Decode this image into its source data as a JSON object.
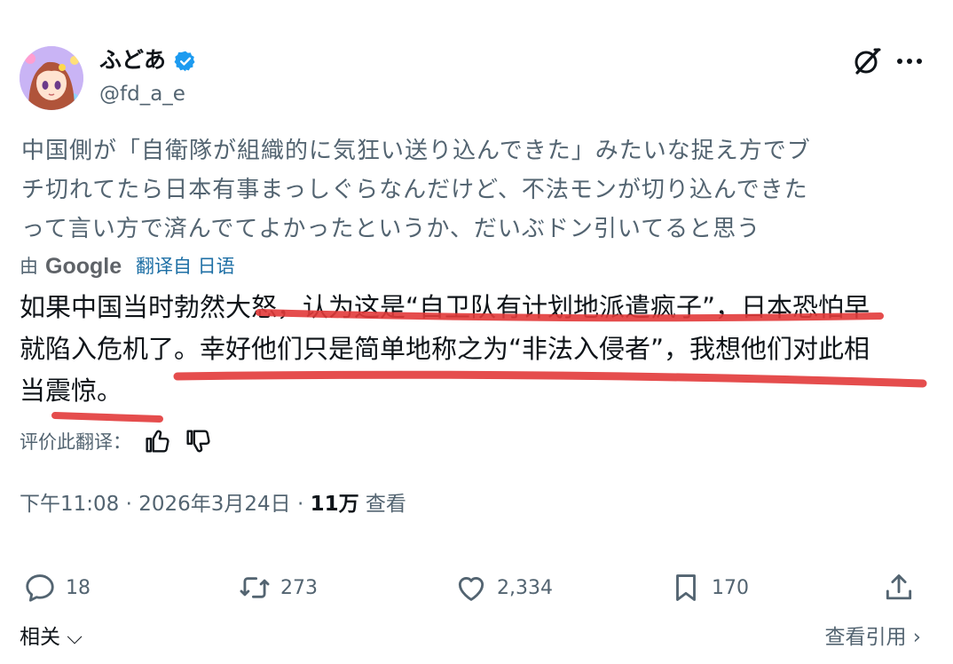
{
  "author": {
    "display_name": "ふどあ",
    "handle": "@fd_a_e",
    "verified": true,
    "verified_color": "#1d9bf0"
  },
  "header_icons": [
    "grok-icon",
    "more-icon"
  ],
  "tweet": {
    "original_lines": [
      "中国側が「自衛隊が組織的に気狂い送り込んできた」みたいな捉え方でブ",
      "チ切れてたら日本有事まっしぐらなんだけど、不法モンが切り込んできた",
      "って言い方で済んでてよかったというか、だいぶドン引いてると思う"
    ],
    "translation_by": "由",
    "translation_service": "Google",
    "translation_source": "翻译自 日语",
    "translated_lines": [
      "如果中国当时勃然大怒，认为这是“自卫队有计划地派遣疯子”，日本恐怕早",
      "就陷入危机了。幸好他们只是简单地称之为“非法入侵者”，我想他们对此相",
      "当震惊。"
    ],
    "rate_label": "评价此翻译：",
    "annotation_color": "#e23a3a"
  },
  "meta": {
    "time_date": "下午11:08 · 2026年3月24日 · ",
    "views": "11万",
    "views_label": " 查看"
  },
  "actions": {
    "replies": "18",
    "retweets": "273",
    "likes": "2,334",
    "bookmarks": "170"
  },
  "footer": {
    "related_label": "相关",
    "quotes_label": "查看引用"
  }
}
